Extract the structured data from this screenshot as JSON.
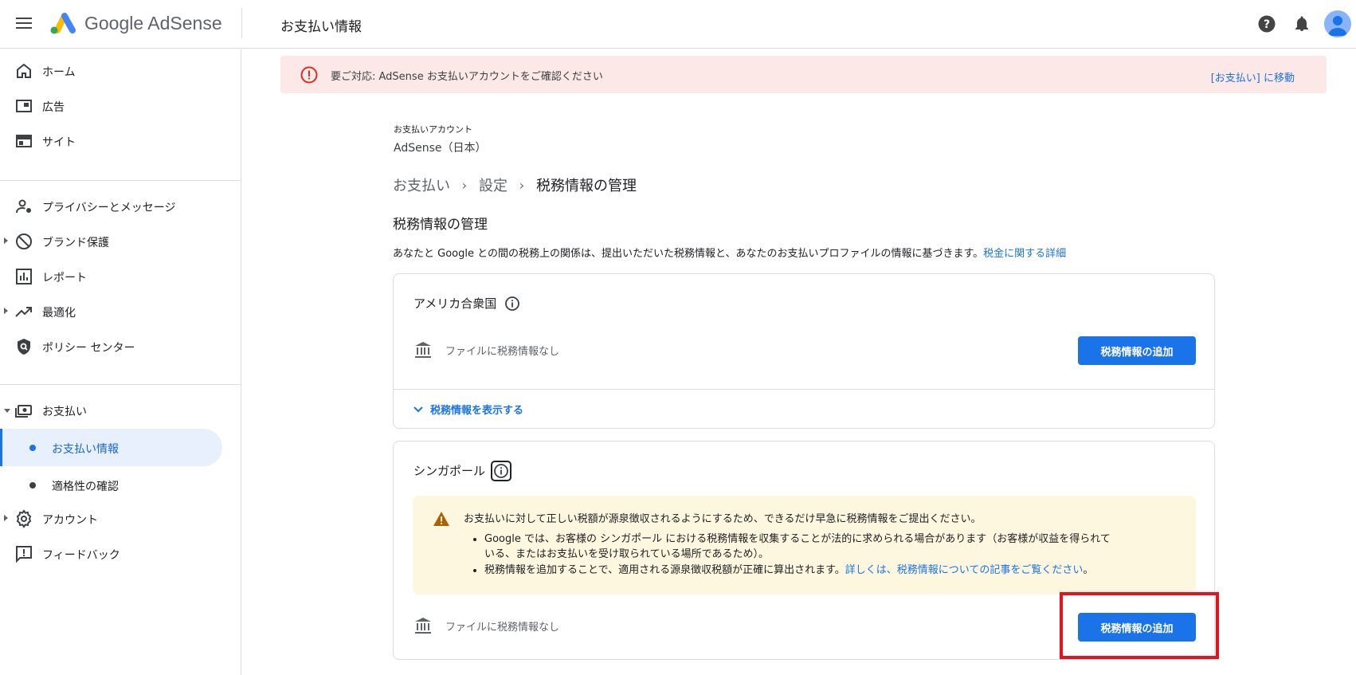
{
  "app": {
    "brand": "Google AdSense",
    "page_title": "お支払い情報"
  },
  "sidebar": {
    "items": [
      {
        "label": "ホーム",
        "icon": "home-icon"
      },
      {
        "label": "広告",
        "icon": "ads-icon"
      },
      {
        "label": "サイト",
        "icon": "sites-icon"
      },
      {
        "label": "プライバシーとメッセージ",
        "icon": "privacy-icon"
      },
      {
        "label": "ブランド保護",
        "icon": "block-icon"
      },
      {
        "label": "レポート",
        "icon": "reports-icon"
      },
      {
        "label": "最適化",
        "icon": "trending-icon"
      },
      {
        "label": "ポリシー センター",
        "icon": "policy-shield-icon"
      },
      {
        "label": "お支払い",
        "icon": "payments-icon"
      },
      {
        "label": "アカウント",
        "icon": "gear-icon"
      },
      {
        "label": "フィードバック",
        "icon": "feedback-icon"
      }
    ],
    "payment_sub": [
      {
        "label": "お支払い情報"
      },
      {
        "label": "適格性の確認"
      }
    ]
  },
  "alert": {
    "text": "要ご対応: AdSense お支払いアカウントをご確認ください",
    "link": "[お支払い] に移動",
    "color": "#fce8e6"
  },
  "account": {
    "label": "お支払いアカウント",
    "value": "AdSense（日本）"
  },
  "breadcrumb": [
    "お支払い",
    "設定",
    "税務情報の管理"
  ],
  "section": {
    "title": "税務情報の管理",
    "description": "あなたと Google との間の税務上の関係は、提出いただいた税務情報と、あなたのお支払いプロファイルの情報に基づきます。",
    "link": "税金に関する詳細"
  },
  "cards": [
    {
      "country": "アメリカ合衆国",
      "file_status": "ファイルに税務情報なし",
      "button": "税務情報の追加",
      "expand": "税務情報を表示する"
    },
    {
      "country": "シンガポール",
      "warning": {
        "main": "お支払いに対して正しい税額が源泉徴収されるようにするため、できるだけ早急に税務情報をご提出ください。",
        "bullet1_line1": "Google では、お客様の シンガポール における税務情報を収集することが法的に求められる場合があります（お客様が収益を得られて",
        "bullet1_line2": "いる、またはお支払いを受け取られている場所であるため）。",
        "bullet2_text": "税務情報を追加することで、適用される源泉徴収税額が正確に算出されます。",
        "bullet2_link": "詳しくは、税務情報についての記事をご覧ください",
        "bullet2_end": "。"
      },
      "file_status": "ファイルに税務情報なし",
      "button": "税務情報の追加"
    }
  ],
  "colors": {
    "accent": "#1a73e8",
    "highlight": "#e8111e",
    "warning_bg": "#fef7e0"
  }
}
